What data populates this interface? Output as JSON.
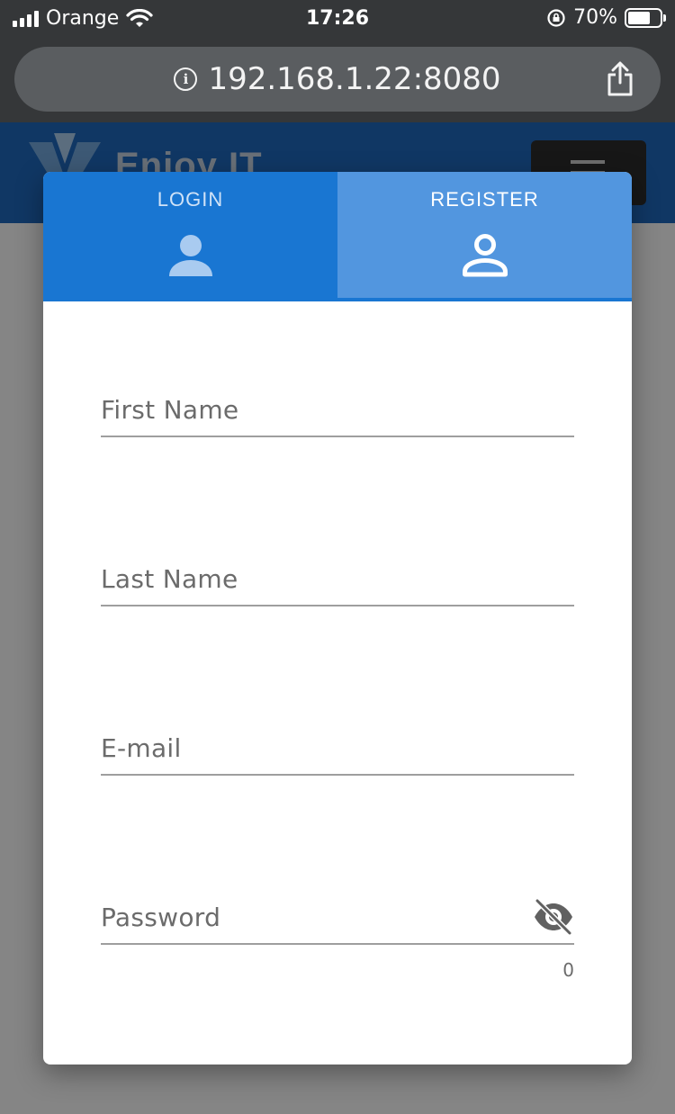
{
  "status_bar": {
    "carrier": "Orange",
    "time": "17:26",
    "battery": "70%"
  },
  "browser": {
    "url": "192.168.1.22:8080"
  },
  "page_header": {
    "brand": "Enjoy IT"
  },
  "dialog": {
    "tabs": [
      {
        "label": "LOGIN",
        "icon": "account-filled-icon",
        "active": false
      },
      {
        "label": "REGISTER",
        "icon": "account-outline-icon",
        "active": true
      }
    ],
    "fields": {
      "first_name": {
        "placeholder": "First Name",
        "value": ""
      },
      "last_name": {
        "placeholder": "Last Name",
        "value": ""
      },
      "email": {
        "placeholder": "E-mail",
        "value": ""
      },
      "password": {
        "placeholder": "Password",
        "value": "",
        "counter": "0"
      }
    }
  },
  "colors": {
    "tab_login_bg": "#1976d2",
    "tab_register_bg": "#5296df",
    "header_bg": "#1e65b7"
  }
}
